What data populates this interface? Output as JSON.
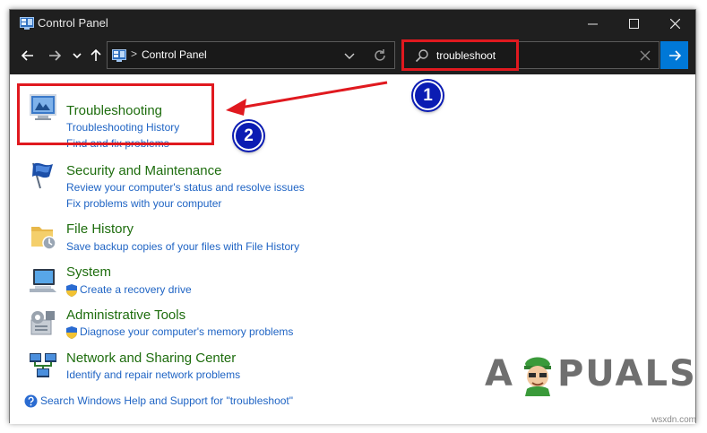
{
  "window": {
    "title": "Control Panel"
  },
  "navbar": {
    "address_path": "Control Panel",
    "separator": ">"
  },
  "search": {
    "value": "troubleshoot"
  },
  "results": [
    {
      "title": "Troubleshooting",
      "links": [
        "Troubleshooting History",
        "Find and fix problems"
      ],
      "icon": "troubleshooting-icon"
    },
    {
      "title": "Security and Maintenance",
      "links": [
        "Review your computer's status and resolve issues",
        "Fix problems with your computer"
      ],
      "icon": "security-flag-icon"
    },
    {
      "title": "File History",
      "links": [
        "Save backup copies of your files with File History"
      ],
      "icon": "file-history-icon"
    },
    {
      "title": "System",
      "links": [
        "Create a recovery drive"
      ],
      "icon": "system-computer-icon",
      "shield": true
    },
    {
      "title": "Administrative Tools",
      "links": [
        "Diagnose your computer's memory problems"
      ],
      "icon": "admin-tools-icon",
      "shield": true
    },
    {
      "title": "Network and Sharing Center",
      "links": [
        "Identify and repair network problems"
      ],
      "icon": "network-icon"
    }
  ],
  "help_link": "Search Windows Help and Support for \"troubleshoot\"",
  "annotations": {
    "badge_1": "1",
    "badge_2": "2"
  },
  "watermark": {
    "logo_left": "A",
    "logo_right": "PUALS",
    "site": "wsxdn.com"
  },
  "colors": {
    "title_green": "#1e6d0e",
    "link_blue": "#1f64c4",
    "callout_red": "#e0191f",
    "badge_blue": "#0b1cb3",
    "accent": "#0078d7"
  }
}
